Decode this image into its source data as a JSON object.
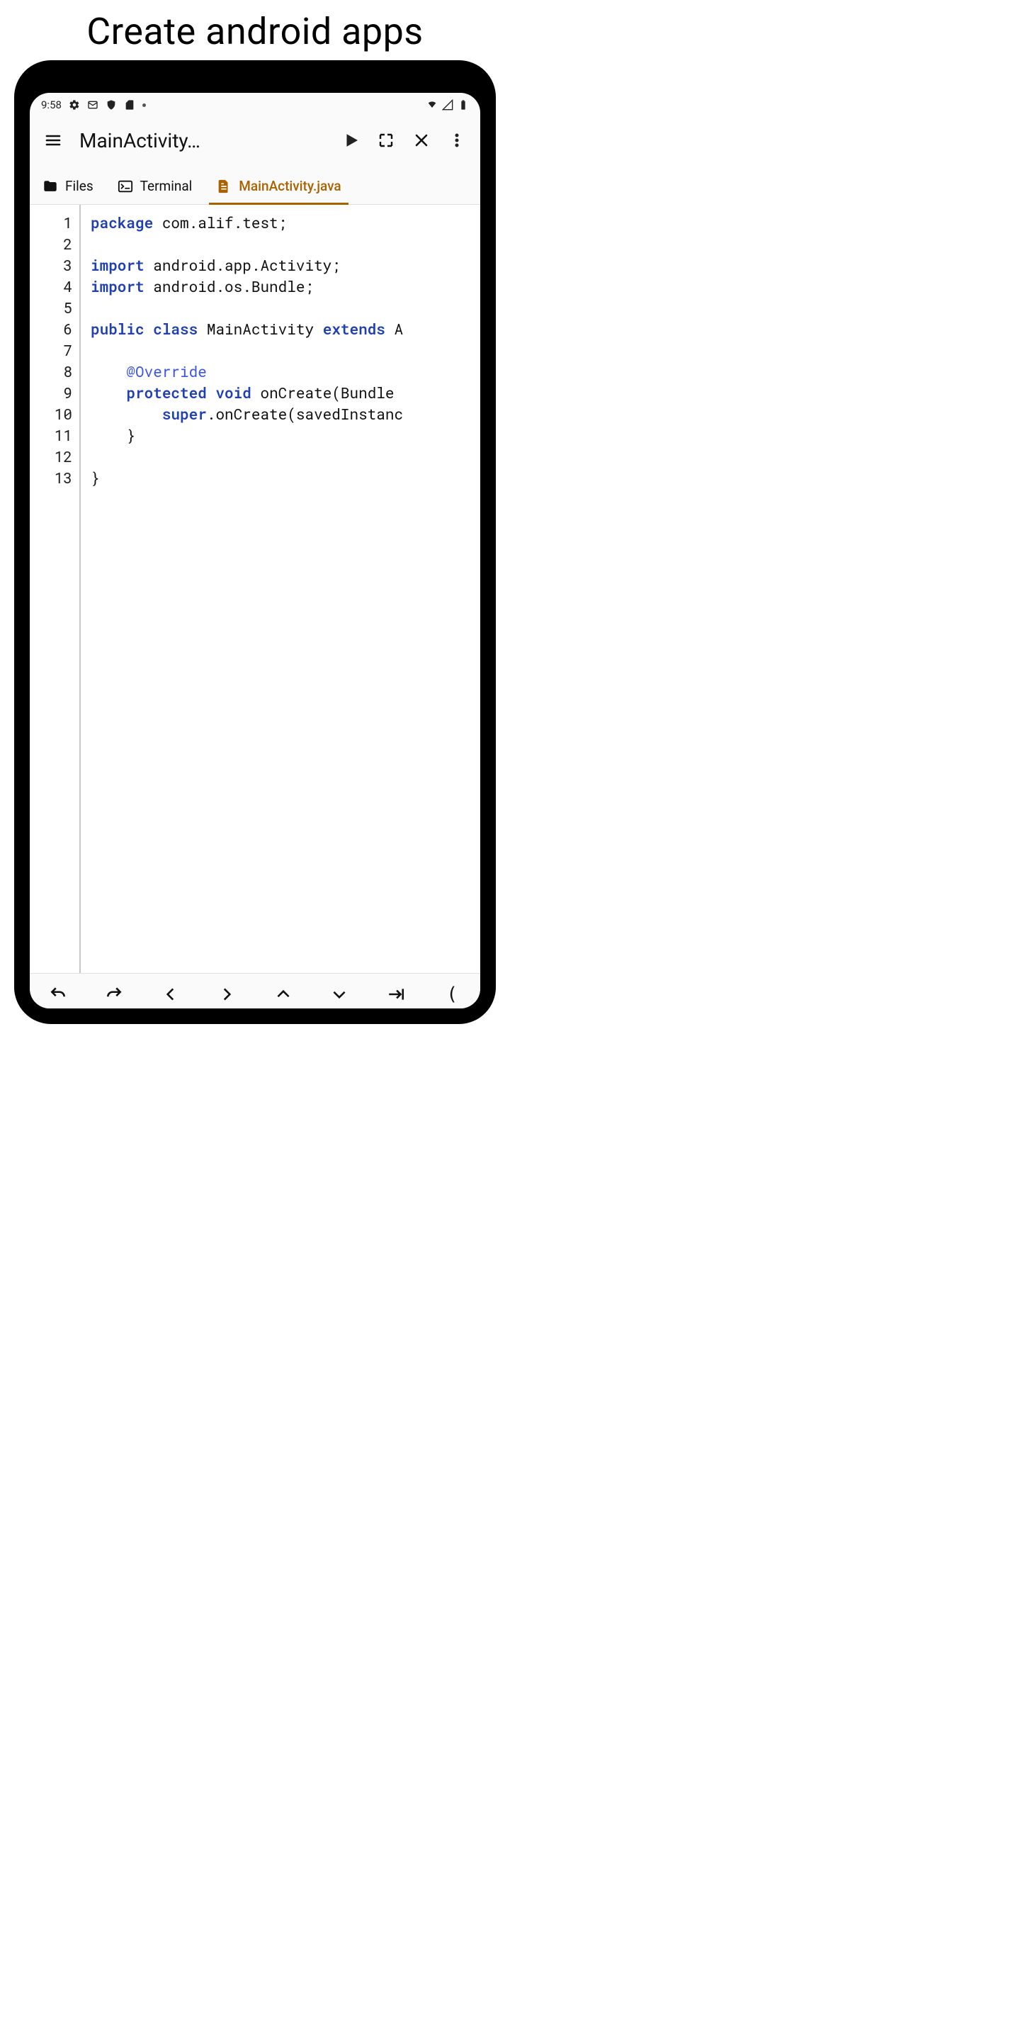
{
  "headline": "Create android apps",
  "statusbar": {
    "time": "9:58"
  },
  "appbar": {
    "title": "MainActivity…"
  },
  "tabs": {
    "files": {
      "label": "Files"
    },
    "terminal": {
      "label": "Terminal"
    },
    "editor": {
      "label": "MainActivity.java"
    }
  },
  "editor": {
    "line_numbers": [
      "1",
      "2",
      "3",
      "4",
      "5",
      "6",
      "7",
      "8",
      "9",
      "10",
      "11",
      "12",
      "13"
    ],
    "lines": [
      {
        "tokens": [
          {
            "cls": "kw",
            "t": "package"
          },
          {
            "cls": "txt",
            "t": " com.alif.test;"
          }
        ]
      },
      {
        "tokens": [
          {
            "cls": "txt",
            "t": ""
          }
        ]
      },
      {
        "tokens": [
          {
            "cls": "kw",
            "t": "import"
          },
          {
            "cls": "txt",
            "t": " android.app.Activity;"
          }
        ]
      },
      {
        "tokens": [
          {
            "cls": "kw",
            "t": "import"
          },
          {
            "cls": "txt",
            "t": " android.os.Bundle;"
          }
        ]
      },
      {
        "tokens": [
          {
            "cls": "txt",
            "t": ""
          }
        ]
      },
      {
        "tokens": [
          {
            "cls": "kw",
            "t": "public"
          },
          {
            "cls": "txt",
            "t": " "
          },
          {
            "cls": "kw",
            "t": "class"
          },
          {
            "cls": "txt",
            "t": " MainActivity "
          },
          {
            "cls": "kw",
            "t": "extends"
          },
          {
            "cls": "txt",
            "t": " A"
          }
        ]
      },
      {
        "tokens": [
          {
            "cls": "txt",
            "t": ""
          }
        ]
      },
      {
        "tokens": [
          {
            "cls": "txt",
            "t": "    "
          },
          {
            "cls": "ann",
            "t": "@Override"
          }
        ]
      },
      {
        "tokens": [
          {
            "cls": "txt",
            "t": "    "
          },
          {
            "cls": "kw",
            "t": "protected"
          },
          {
            "cls": "txt",
            "t": " "
          },
          {
            "cls": "kw",
            "t": "void"
          },
          {
            "cls": "txt",
            "t": " onCreate(Bundle"
          }
        ]
      },
      {
        "tokens": [
          {
            "cls": "txt",
            "t": "        "
          },
          {
            "cls": "kw",
            "t": "super"
          },
          {
            "cls": "txt",
            "t": ".onCreate(savedInstanc"
          }
        ]
      },
      {
        "tokens": [
          {
            "cls": "txt",
            "t": "    }"
          }
        ]
      },
      {
        "tokens": [
          {
            "cls": "txt",
            "t": ""
          }
        ]
      },
      {
        "tokens": [
          {
            "cls": "txt",
            "t": "}"
          }
        ]
      }
    ]
  },
  "bottombar": {
    "paren": "("
  }
}
